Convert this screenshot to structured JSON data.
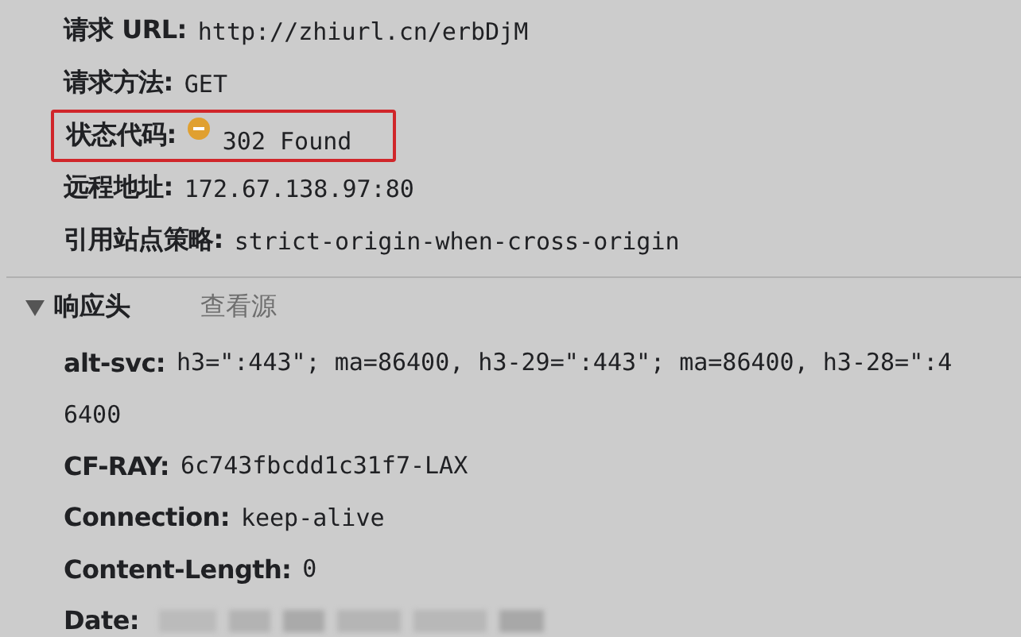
{
  "general": [
    {
      "label": "请求 URL:",
      "value": "http://zhiurl.cn/erbDjM",
      "highlighted": false
    },
    {
      "label": "请求方法:",
      "value": "GET",
      "highlighted": false
    },
    {
      "label": "状态代码:",
      "value": "302 Found",
      "highlighted": true,
      "kind": "status"
    },
    {
      "label": "远程地址:",
      "value": "172.67.138.97:80",
      "highlighted": false
    },
    {
      "label": "引用站点策略:",
      "value": "strict-origin-when-cross-origin",
      "highlighted": false
    }
  ],
  "response_headers": {
    "title": "响应头",
    "expanded": true,
    "view_source": "查看源",
    "rows": [
      {
        "label": "alt-svc:",
        "value_lines": [
          "h3=\":443\"; ma=86400, h3-29=\":443\"; ma=86400, h3-28=\":4",
          "6400"
        ]
      },
      {
        "label": "CF-RAY:",
        "value_lines": [
          "6c743fbcdd1c31f7-LAX"
        ]
      },
      {
        "label": "Connection:",
        "value_lines": [
          "keep-alive"
        ]
      },
      {
        "label": "Content-Length:",
        "value_lines": [
          "0"
        ]
      },
      {
        "label": "Date:",
        "redacted": true
      }
    ]
  }
}
